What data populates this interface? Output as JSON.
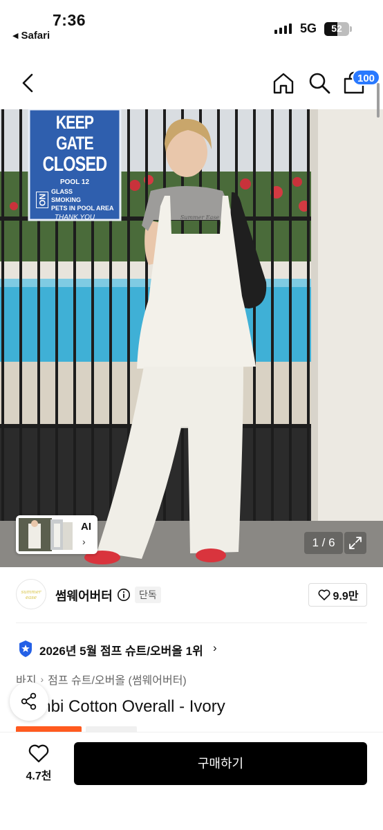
{
  "status_bar": {
    "time": "7:36",
    "back_app": "Safari",
    "network": "5G",
    "battery": "52",
    "battery_level": 0.52
  },
  "nav": {
    "back_icon": "chevron-left-icon",
    "home_icon": "home-icon",
    "search_icon": "search-icon",
    "cart_icon": "cart-icon",
    "cart_badge": "100",
    "badge_color": "#2979ff"
  },
  "gallery": {
    "sign": {
      "line1": "KEEP GATE",
      "line2": "CLOSED",
      "line3": "POOL 12",
      "no": "NO",
      "items": [
        "GLASS",
        "SMOKING",
        "PETS IN POOL AREA"
      ],
      "thanks": "THANK YOU"
    },
    "shirt_print": "Summer Ease",
    "ai_label": "AI",
    "counter": "1 / 6"
  },
  "brand": {
    "logo_text": "summer ease",
    "name": "썸웨어버터",
    "exclusive_badge": "단독",
    "like_count": "9.9만"
  },
  "ranking": {
    "text": "2026년 5월 점프 슈트/오버올 1위"
  },
  "breadcrumb": {
    "level1": "바지",
    "level2": "점프 슈트/오버올 (썸웨어버터)"
  },
  "product": {
    "title": "Combi Cotton Overall - Ivory"
  },
  "bottom": {
    "wish_count": "4.7천",
    "buy_label": "구매하기"
  },
  "colors": {
    "accent_blue": "#2979ff",
    "sale_orange": "#ff5a1f",
    "buy_button": "#000000"
  }
}
